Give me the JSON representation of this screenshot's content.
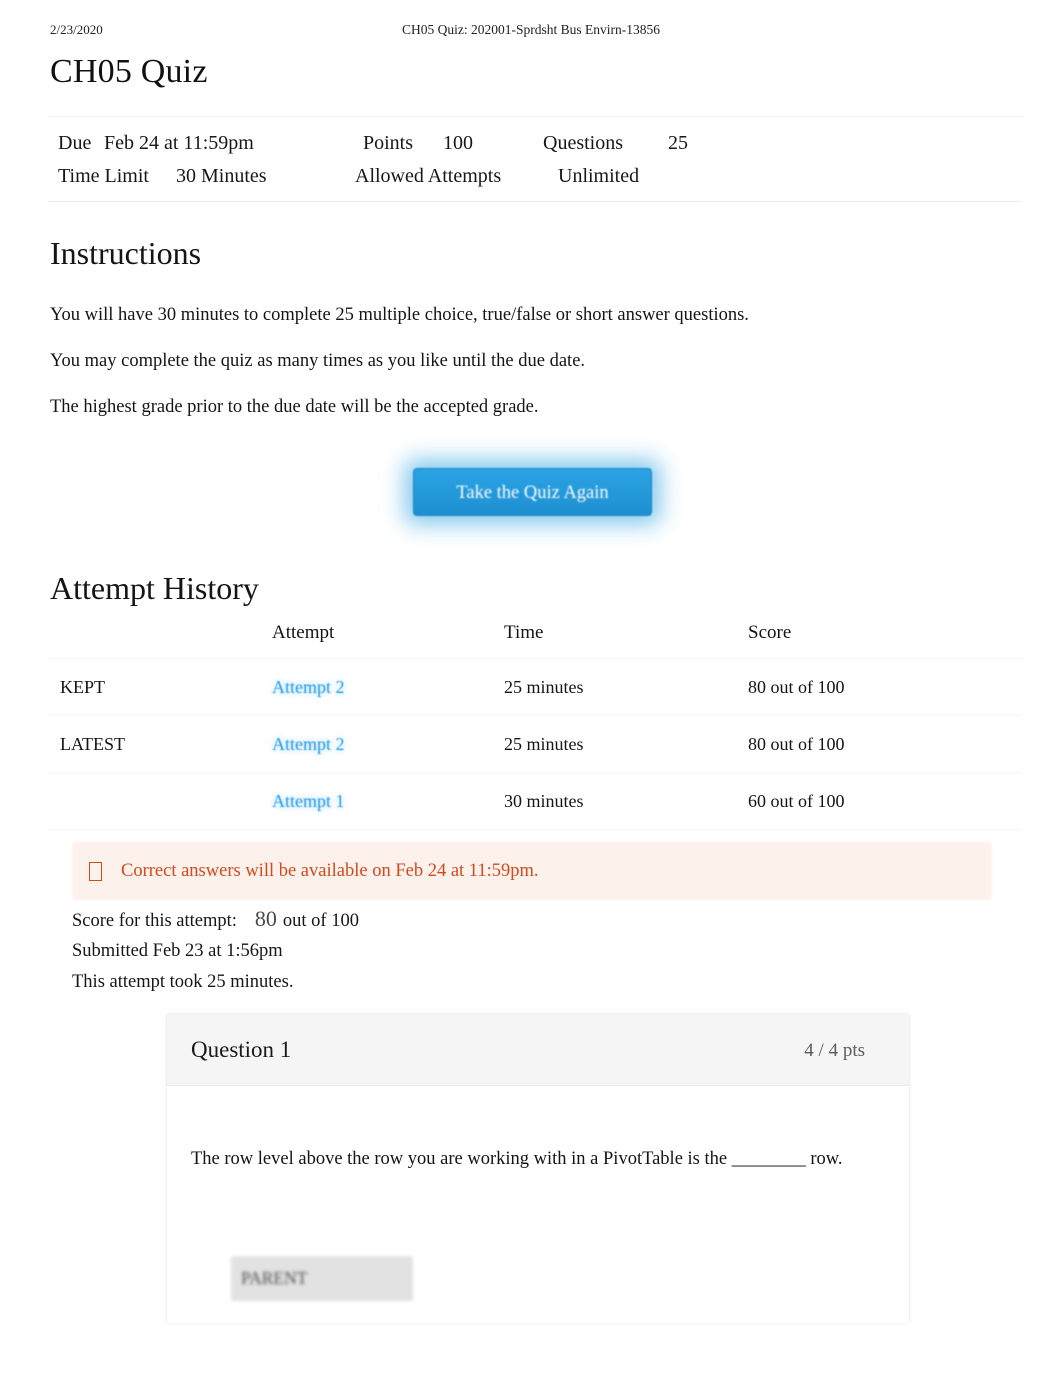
{
  "print_header": {
    "date": "2/23/2020",
    "title": "CH05 Quiz: 202001-Sprdsht Bus Envirn-13856"
  },
  "page_title": "CH05 Quiz",
  "quiz_info": {
    "due_label": "Due",
    "due_value": "Feb 24 at 11:59pm",
    "points_label": "Points",
    "points_value": "100",
    "questions_label": "Questions",
    "questions_value": "25",
    "time_limit_label": "Time Limit",
    "time_limit_value": "30 Minutes",
    "allowed_attempts_label": "Allowed Attempts",
    "allowed_attempts_value": "Unlimited"
  },
  "instructions": {
    "heading": "Instructions",
    "paragraphs": [
      "You will have 30    minutes to complete 25 multiple choice, true/false or short answer questions.",
      "You may complete the quiz as many times as you like until the due date.",
      "The highest grade prior to the due date will be the accepted grade."
    ]
  },
  "take_quiz_button": {
    "label": "Take the Quiz Again",
    "color": "#1f96db"
  },
  "attempt_history": {
    "heading": "Attempt History",
    "columns": [
      "",
      "Attempt",
      "Time",
      "Score"
    ],
    "rows": [
      {
        "tag": "KEPT",
        "attempt": "Attempt 2",
        "time": "25 minutes",
        "score": "80 out of 100"
      },
      {
        "tag": "LATEST",
        "attempt": "Attempt 2",
        "time": "25 minutes",
        "score": "80 out of 100"
      },
      {
        "tag": "",
        "attempt": "Attempt 1",
        "time": "30 minutes",
        "score": "60 out of 100"
      }
    ],
    "link_color": "#1f9ce8"
  },
  "notice": {
    "icon": "info-box-icon",
    "text": "Correct answers will be available on Feb 24 at 11:59pm.",
    "color": "#d2491e",
    "background": "#fdf1ec"
  },
  "attempt_summary": {
    "score_label": "Score for this attempt:",
    "score_value": "80",
    "score_suffix": "out of 100",
    "submitted": "Submitted Feb 23 at 1:56pm",
    "duration": "This attempt took 25 minutes."
  },
  "question": {
    "title": "Question 1",
    "points": "4 / 4 pts",
    "text": "The row level above the row you are working with in a PivotTable is the ________ row.",
    "answer": "PARENT"
  }
}
